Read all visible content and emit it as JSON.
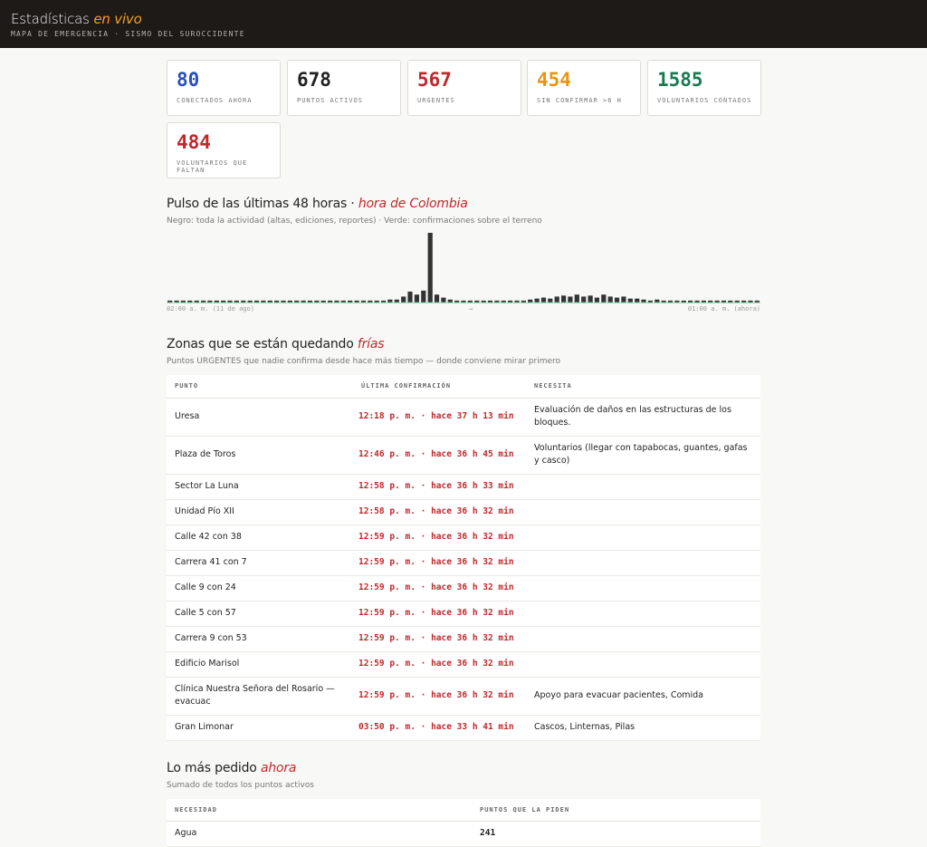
{
  "header": {
    "title": "Estadísticas",
    "title_em": "en vivo",
    "subtitle": "MAPA DE EMERGENCIA · SISMO DEL SUROCCIDENTE"
  },
  "stats": [
    {
      "value": "80",
      "label": "CONECTADOS AHORA",
      "color": "#2a4fbf"
    },
    {
      "value": "678",
      "label": "PUNTOS ACTIVOS",
      "color": "#222222"
    },
    {
      "value": "567",
      "label": "URGENTES",
      "color": "#c0282c"
    },
    {
      "value": "454",
      "label": "SIN CONFIRMAR >6 H",
      "color": "#e8960f"
    },
    {
      "value": "1585",
      "label": "VOLUNTARIOS CONTADOS",
      "color": "#1a7a50"
    },
    {
      "value": "484",
      "label": "VOLUNTARIOS QUE FALTAN",
      "color": "#c0282c"
    }
  ],
  "pulse": {
    "title": "Pulso de las últimas 48 horas ·",
    "title_em": "hora de Colombia",
    "subtitle": "Negro: toda la actividad (altas, ediciones, reportes) · Verde: confirmaciones sobre el terreno",
    "axis_start": "02:00 a. m. (11 de ago)",
    "axis_mid": "→",
    "axis_end": "01:00 a. m. (ahora)"
  },
  "chart_data": {
    "type": "bar",
    "title": "",
    "series": [
      {
        "name": "Negro: toda la actividad",
        "color": "#333333",
        "values": [
          2,
          2,
          2,
          2,
          2,
          2,
          2,
          2,
          2,
          2,
          2,
          2,
          2,
          2,
          2,
          2,
          2,
          2,
          2,
          2,
          2,
          2,
          2,
          2,
          2,
          2,
          2,
          2,
          2,
          2,
          2,
          2,
          2,
          3,
          3,
          6,
          11,
          8,
          12,
          70,
          8,
          5,
          3,
          2,
          2,
          2,
          2,
          2,
          2,
          2,
          2,
          2,
          2,
          2,
          3,
          4,
          5,
          4,
          6,
          7,
          6,
          8,
          6,
          7,
          5,
          8,
          6,
          5,
          6,
          4,
          4,
          3,
          2,
          3,
          2,
          2,
          2,
          2,
          2,
          2,
          2,
          2,
          2,
          2,
          2,
          2,
          2,
          2,
          2
        ]
      },
      {
        "name": "Verde: confirmaciones sobre el terreno",
        "color": "#2a8a5c",
        "values": [
          1,
          1,
          1,
          1,
          1,
          1,
          1,
          1,
          1,
          1,
          1,
          1,
          1,
          1,
          1,
          1,
          1,
          1,
          1,
          1,
          1,
          1,
          1,
          1,
          1,
          1,
          1,
          1,
          1,
          1,
          1,
          1,
          1,
          1,
          1,
          1,
          1,
          1,
          1,
          1,
          1,
          1,
          1,
          1,
          1,
          1,
          1,
          1,
          1,
          1,
          1,
          1,
          1,
          1,
          1,
          1,
          1,
          1,
          1,
          1,
          1,
          1,
          1,
          1,
          1,
          1,
          1,
          1,
          1,
          1,
          1,
          1,
          1,
          1,
          1,
          1,
          1,
          1,
          1,
          1,
          1,
          1,
          1,
          1,
          1,
          1,
          1,
          1,
          1
        ]
      }
    ]
  },
  "cold": {
    "title": "Zonas que se están quedando",
    "title_em": "frías",
    "subtitle": "Puntos URGENTES que nadie confirma desde hace más tiempo — donde conviene mirar primero",
    "columns": [
      "PUNTO",
      "ÚLTIMA CONFIRMACIÓN",
      "NECESITA"
    ],
    "rows": [
      {
        "punto": "Uresa",
        "time": "12:18 p. m. · hace 37 h 13 min",
        "necesita": "Evaluación de daños en las estructuras de los bloques."
      },
      {
        "punto": "Plaza de Toros",
        "time": "12:46 p. m. · hace 36 h 45 min",
        "necesita": "Voluntarios (llegar con tapabocas, guantes, gafas y casco)"
      },
      {
        "punto": "Sector La Luna",
        "time": "12:58 p. m. · hace 36 h 33 min",
        "necesita": ""
      },
      {
        "punto": "Unidad Pío XII",
        "time": "12:58 p. m. · hace 36 h 32 min",
        "necesita": ""
      },
      {
        "punto": "Calle 42 con 38",
        "time": "12:59 p. m. · hace 36 h 32 min",
        "necesita": ""
      },
      {
        "punto": "Carrera 41 con 7",
        "time": "12:59 p. m. · hace 36 h 32 min",
        "necesita": ""
      },
      {
        "punto": "Calle 9 con 24",
        "time": "12:59 p. m. · hace 36 h 32 min",
        "necesita": ""
      },
      {
        "punto": "Calle 5 con 57",
        "time": "12:59 p. m. · hace 36 h 32 min",
        "necesita": ""
      },
      {
        "punto": "Carrera 9 con 53",
        "time": "12:59 p. m. · hace 36 h 32 min",
        "necesita": ""
      },
      {
        "punto": "Edificio Marisol",
        "time": "12:59 p. m. · hace 36 h 32 min",
        "necesita": ""
      },
      {
        "punto": "Clínica Nuestra Señora del Rosario — evacuac",
        "time": "12:59 p. m. · hace 36 h 32 min",
        "necesita": "Apoyo para evacuar pacientes, Comida"
      },
      {
        "punto": "Gran Limonar",
        "time": "03:50 p. m. · hace 33 h 41 min",
        "necesita": "Cascos, Linternas, Pilas"
      }
    ]
  },
  "most": {
    "title": "Lo más pedido",
    "title_em": "ahora",
    "subtitle": "Sumado de todos los puntos activos",
    "columns": [
      "NECESIDAD",
      "PUNTOS QUE LA PIDEN"
    ],
    "rows": [
      {
        "necesidad": "Agua",
        "puntos": "241"
      }
    ]
  }
}
